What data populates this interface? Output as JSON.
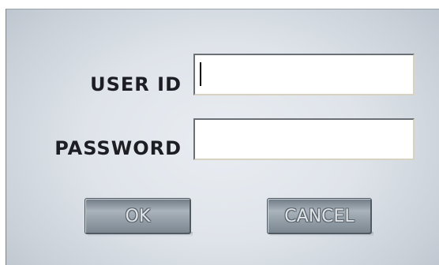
{
  "login": {
    "user_id_label": "USER ID",
    "user_id_value": "",
    "password_label": "PASSWORD",
    "password_value": "",
    "ok_label": "OK",
    "cancel_label": "CANCEL"
  },
  "colors": {
    "dialog_background": "#dfe4ea",
    "button_face": "#9aa4ad",
    "label_text": "#1c1e24"
  }
}
